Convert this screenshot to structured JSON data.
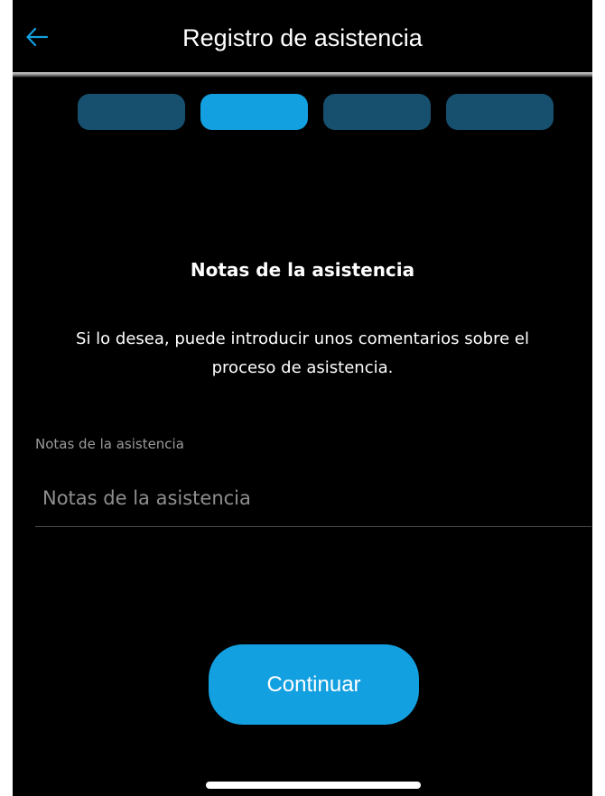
{
  "app_bar": {
    "title": "Registro de asistencia",
    "back_icon": "arrow-left-icon",
    "accent_color": "#13a0e0"
  },
  "stepper": {
    "total_steps": 4,
    "current_step": 2,
    "active_color": "#13a0e0",
    "inactive_color": "#17506f"
  },
  "content": {
    "title": "Notas de la asistencia",
    "description": "Si lo desea, puede introducir unos comentarios sobre el proceso de asistencia."
  },
  "notes_field": {
    "label": "Notas de la asistencia",
    "placeholder": "Notas de la asistencia",
    "value": ""
  },
  "actions": {
    "continue_label": "Continuar"
  }
}
